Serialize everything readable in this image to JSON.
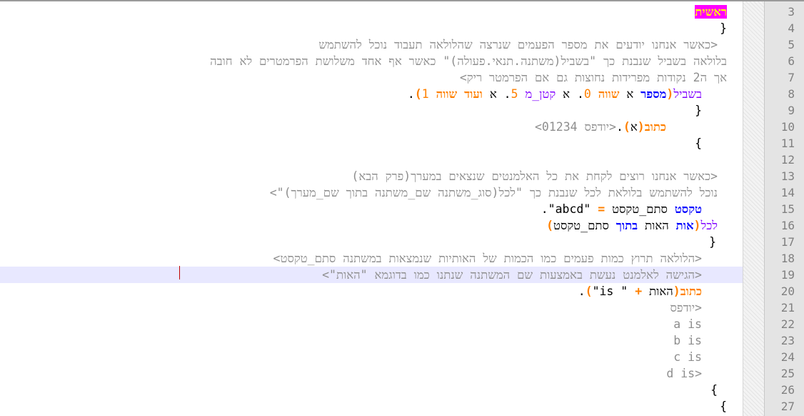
{
  "editor": {
    "colors": {
      "background": "#ffffff",
      "current_line": "#e8e8ff",
      "gutter": "#e4e4e4",
      "line_number": "#808080",
      "comment": "#8e8e8e",
      "keyword_purple": "#8000ff",
      "operator_orange": "#ff8000",
      "type_blue": "#0000ff",
      "selected_word_fg": "#ffff00",
      "selected_word_bg": "#ff00ff",
      "caret": "#c00000"
    },
    "current_line_number": 19,
    "lines": [
      {
        "n": "3",
        "segs": [
          {
            "t": "ראשית",
            "c": "kw-sel"
          }
        ]
      },
      {
        "n": "4",
        "segs": [
          {
            "t": "}",
            "c": "brace"
          }
        ]
      },
      {
        "n": "5",
        "segs": [
          {
            "t": "<כאשר אנחנו יודעים את מספר הפעמים שנרצה שהלולאה תעבוד נוכל להשתמש",
            "c": "comment"
          }
        ]
      },
      {
        "n": "6",
        "segs": [
          {
            "t": "בלולאה בשביל שנבנת כך \"בשביל(משתנה.תנאי.פעולה)\" כאשר אף אחד משלושת הפרמטרים לא חובה",
            "c": "comment"
          }
        ]
      },
      {
        "n": "7",
        "segs": [
          {
            "t": "אך ה2 נקודות מפרידות נחוצות גם אם הפרמטר ריק>",
            "c": "comment"
          }
        ]
      },
      {
        "n": "8",
        "segs": [
          {
            "t": "בשביל",
            "c": "kw"
          },
          {
            "t": "(",
            "c": "op"
          },
          {
            "t": "מספר",
            "c": "type"
          },
          {
            "t": " א ",
            "c": "plain"
          },
          {
            "t": "שווה",
            "c": "bold-o"
          },
          {
            "t": " 0",
            "c": "num"
          },
          {
            "t": ". א ",
            "c": "plain"
          },
          {
            "t": "קטן_מ",
            "c": "kw2"
          },
          {
            "t": " 5",
            "c": "num"
          },
          {
            "t": ". א ",
            "c": "plain"
          },
          {
            "t": "ועוד שווה",
            "c": "bold-o"
          },
          {
            "t": " 1",
            "c": "num"
          },
          {
            "t": ")",
            "c": "op"
          },
          {
            "t": ".",
            "c": "plain"
          }
        ]
      },
      {
        "n": "9",
        "segs": [
          {
            "t": "}",
            "c": "brace"
          }
        ]
      },
      {
        "n": "10",
        "segs": [
          {
            "t": "כתוב",
            "c": "cmd"
          },
          {
            "t": "(",
            "c": "op"
          },
          {
            "t": "א",
            "c": "plain"
          },
          {
            "t": ")",
            "c": "op"
          },
          {
            "t": ".",
            "c": "plain"
          },
          {
            "t": "<יודפס 01234>",
            "c": "comment"
          }
        ]
      },
      {
        "n": "11",
        "segs": [
          {
            "t": "{",
            "c": "brace"
          }
        ]
      },
      {
        "n": "12",
        "segs": []
      },
      {
        "n": "13",
        "segs": [
          {
            "t": "<כאשר אנחנו רוצים לקחת את כל האלמנטים שנצאים במערך(פרק הבא)",
            "c": "comment"
          }
        ]
      },
      {
        "n": "14",
        "segs": [
          {
            "t": "נוכל להשתמש בלולאת לכל שנבנת כך \"לכל(סוג_משתנה שם_משתנה בתוך שם_מערך)\">",
            "c": "comment"
          }
        ]
      },
      {
        "n": "15",
        "segs": [
          {
            "t": "טקסט",
            "c": "type"
          },
          {
            "t": " סתם_טקסט ",
            "c": "plain"
          },
          {
            "t": "=",
            "c": "op"
          },
          {
            "t": " \"abcd\"",
            "c": "str"
          },
          {
            "t": ".",
            "c": "plain"
          }
        ]
      },
      {
        "n": "16",
        "segs": [
          {
            "t": "לכל",
            "c": "kw"
          },
          {
            "t": "(",
            "c": "op"
          },
          {
            "t": "אות",
            "c": "type"
          },
          {
            "t": " האות ",
            "c": "plain"
          },
          {
            "t": "בתוך",
            "c": "type"
          },
          {
            "t": " סתם_טקסט",
            "c": "plain"
          },
          {
            "t": ")",
            "c": "op"
          }
        ]
      },
      {
        "n": "17",
        "segs": [
          {
            "t": "}",
            "c": "brace"
          }
        ]
      },
      {
        "n": "18",
        "segs": [
          {
            "t": "<הלולאה תרוץ כמות פעמים כמו הכמות של האותיות שנמצאות במשתנה סתם_טקסט>",
            "c": "comment"
          }
        ]
      },
      {
        "n": "19",
        "segs": [
          {
            "t": "<הגישה לאלמנט נעשת באמצעות שם המשתנה שנתנו כמו בדוגמא \"האות\">",
            "c": "comment"
          }
        ]
      },
      {
        "n": "20",
        "segs": [
          {
            "t": "כתוב",
            "c": "cmd"
          },
          {
            "t": "(",
            "c": "op"
          },
          {
            "t": "האות ",
            "c": "plain"
          },
          {
            "t": "+",
            "c": "op"
          },
          {
            "t": " \" is\"",
            "c": "str"
          },
          {
            "t": ")",
            "c": "op"
          },
          {
            "t": ".",
            "c": "plain"
          }
        ]
      },
      {
        "n": "21",
        "segs": [
          {
            "t": "<יודפס",
            "c": "comment"
          }
        ]
      },
      {
        "n": "22",
        "segs": [
          {
            "t": "a is",
            "c": "comment"
          }
        ]
      },
      {
        "n": "23",
        "segs": [
          {
            "t": "b is",
            "c": "comment"
          }
        ]
      },
      {
        "n": "24",
        "segs": [
          {
            "t": "c is",
            "c": "comment"
          }
        ]
      },
      {
        "n": "25",
        "segs": [
          {
            "t": "d is>",
            "c": "comment"
          }
        ]
      },
      {
        "n": "26",
        "segs": [
          {
            "t": "{",
            "c": "brace"
          }
        ]
      },
      {
        "n": "27",
        "segs": [
          {
            "t": "{",
            "c": "brace"
          }
        ]
      }
    ]
  }
}
